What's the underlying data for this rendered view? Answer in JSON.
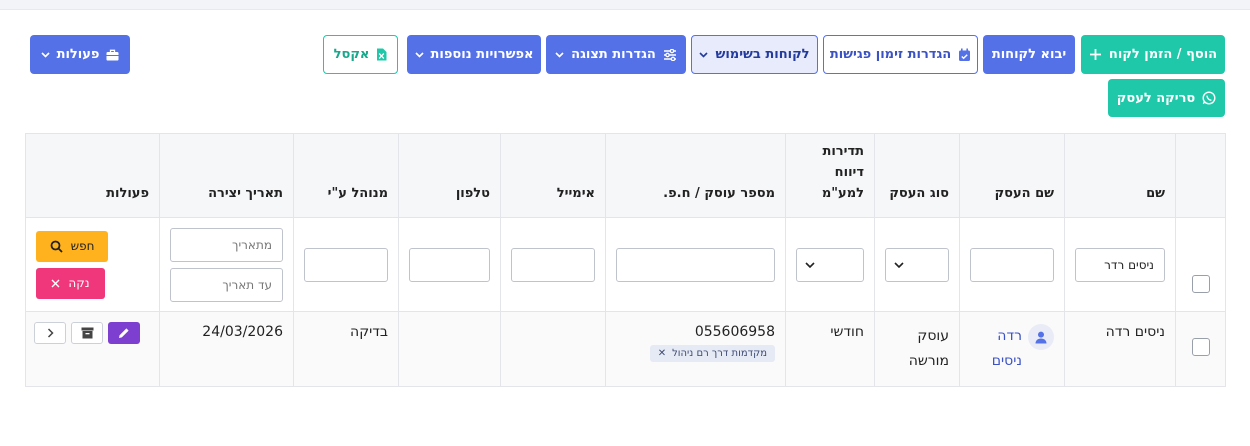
{
  "toolbar": {
    "add_invite_label": "הוסף / הזמן לקוח",
    "import_label": "יבוא לקוחות",
    "meeting_settings_label": "הגדרות זימון פגישות",
    "active_clients_label": "לקוחות בשימוש",
    "display_settings_label": "הגדרות תצוגה",
    "more_options_label": "אפשרויות נוספות",
    "excel_label": "אקסל",
    "actions_label": "פעולות",
    "scan_label": "סריקה לעסק"
  },
  "table": {
    "headers": {
      "name": "שם",
      "business_name": "שם העסק",
      "business_type": "סוג העסק",
      "vat_frequency": "תדירות דיווח למע\"מ",
      "dealer_number": "מספר עוסק / ח.פ.",
      "email": "אימייל",
      "phone": "טלפון",
      "managed_by": "מנוהל ע\"י",
      "created_date": "תאריך יצירה",
      "actions": "פעולות"
    },
    "filters": {
      "name_value": "ניסים רדר",
      "from_date_placeholder": "מתאריך",
      "to_date_placeholder": "עד תאריך",
      "search_label": "חפש",
      "clear_label": "נקה"
    },
    "row": {
      "name": "ניסים רדה",
      "business_name": "רדה ניסים",
      "business_type": "עוסק מורשה",
      "vat_frequency": "חודשי",
      "dealer_number": "055606958",
      "tag": "מקדמות דרך רם ניהול",
      "email": "",
      "phone": "",
      "managed_by": "בדיקה",
      "created_date": "24/03/2026"
    }
  },
  "colors": {
    "primary": "#5571e8",
    "success": "#1fc8a9",
    "warning": "#ffb21e",
    "danger": "#f0377b",
    "edit": "#7c3fd0"
  }
}
